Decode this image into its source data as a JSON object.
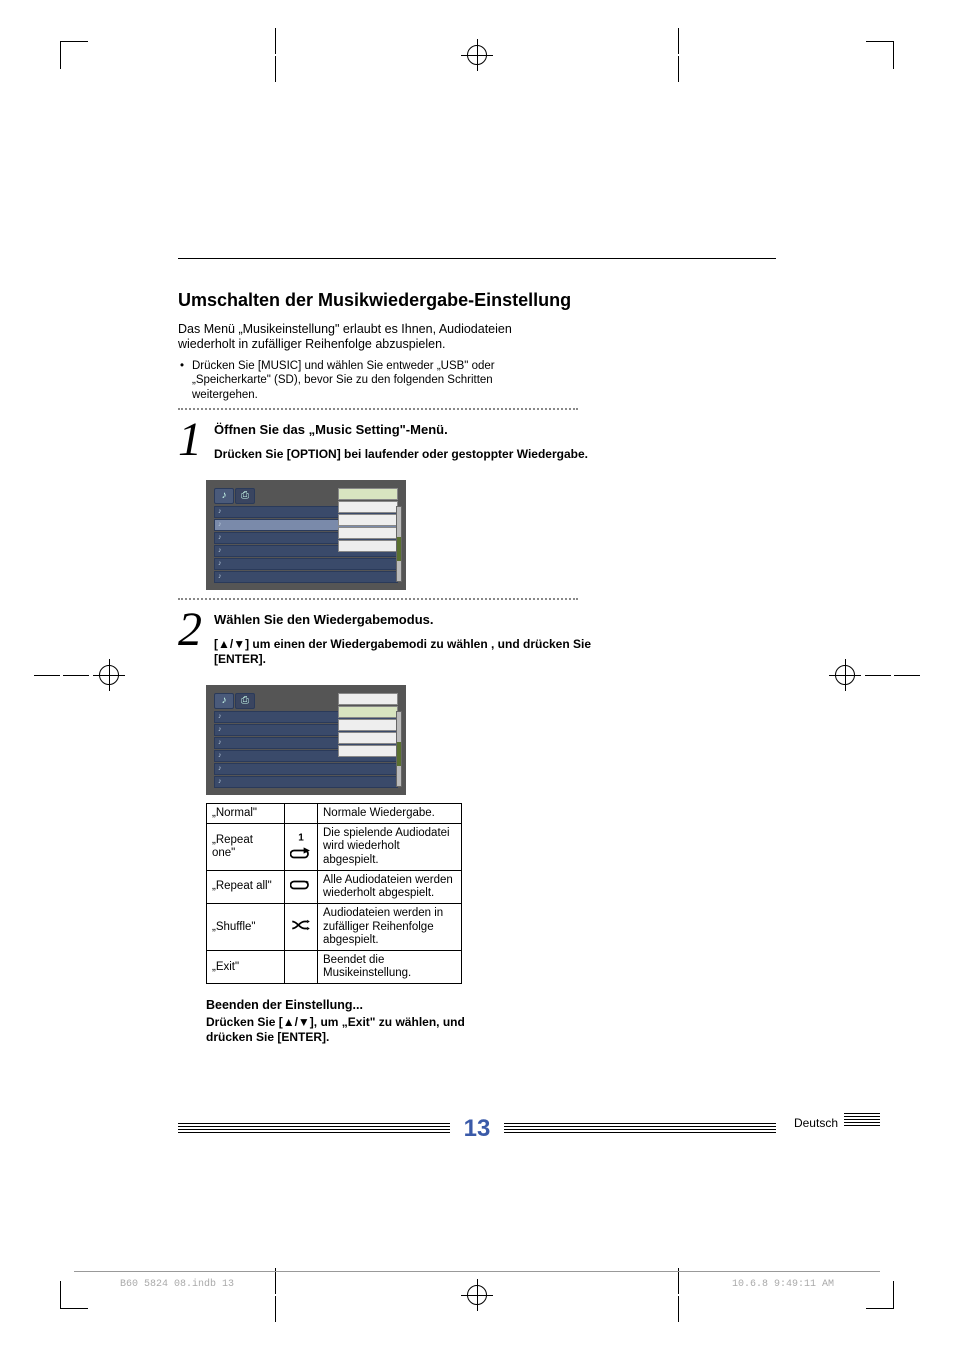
{
  "section_title": "Umschalten der Musikwiedergabe-Einstellung",
  "intro_text": "Das Menü „Musikeinstellung\" erlaubt es Ihnen, Audiodateien wiederholt in zufälliger Reihenfolge abzuspielen.",
  "bullet_text": "Drücken Sie [MUSIC] und wählen Sie entweder „USB\" oder „Speicherkarte\" (SD), bevor Sie zu den folgenden Schritten weitergehen.",
  "step1": {
    "num": "1",
    "title": "Öffnen Sie das „Music Setting\"-Menü.",
    "desc": "Drücken Sie [OPTION] bei laufender oder gestoppter Wiedergabe."
  },
  "step2": {
    "num": "2",
    "title": "Wählen Sie den Wiedergabemodus.",
    "desc": "[▲/▼] um einen der Wiedergabemodi zu wählen , und drücken Sie [ENTER]."
  },
  "modes": [
    {
      "label": "„Normal\"",
      "icon": "",
      "desc": "Normale Wiedergabe."
    },
    {
      "label": "„Repeat one\"",
      "icon": "repeat-one",
      "desc": "Die spielende Audiodatei wird wiederholt abgespielt."
    },
    {
      "label": "„Repeat all\"",
      "icon": "repeat-all",
      "desc": "Alle Audiodateien werden wiederholt abgespielt."
    },
    {
      "label": "„Shuffle\"",
      "icon": "shuffle",
      "desc": "Audiodateien werden in zufälliger Reihenfolge abgespielt."
    },
    {
      "label": "„Exit\"",
      "icon": "",
      "desc": "Beendet die Musikeinstellung."
    }
  ],
  "finish_heading": "Beenden der Einstellung...",
  "finish_text": "Drücken Sie [▲/▼], um „Exit\" zu wählen, und drücken Sie [ENTER].",
  "page_number": "13",
  "language_label": "Deutsch",
  "footer_left": "B60 5824 08.indb   13",
  "footer_right": "10.6.8   9:49:11 AM"
}
